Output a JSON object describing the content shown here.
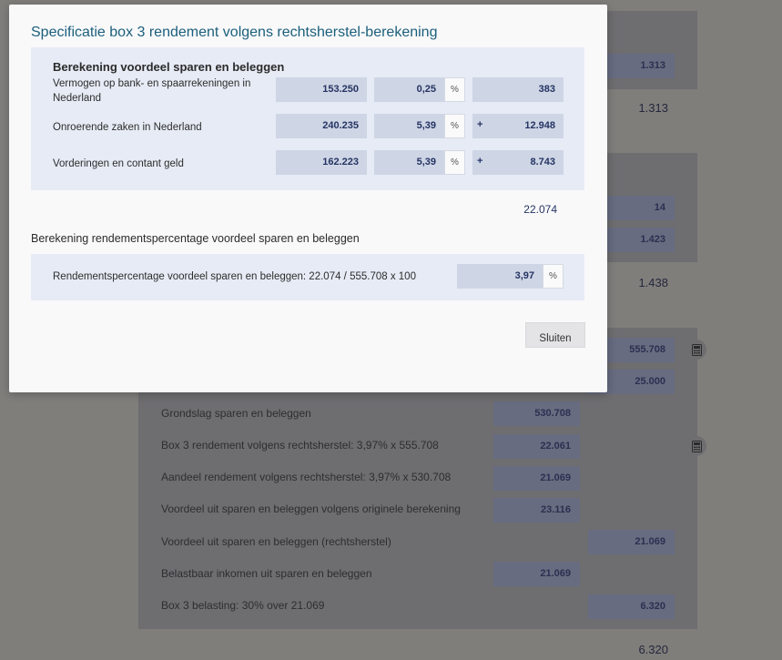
{
  "modal": {
    "title": "Specificatie box 3 rendement volgens rechtsherstel-berekening",
    "section1": {
      "title": "Berekening voordeel sparen en beleggen",
      "rows": [
        {
          "label": "Vermogen op bank- en spaarrekeningen in Nederland",
          "amount": "153.250",
          "percentage": "0,25",
          "percent_sign": "%",
          "operator": "",
          "result": "383"
        },
        {
          "label": "Onroerende zaken in Nederland",
          "amount": "240.235",
          "percentage": "5,39",
          "percent_sign": "%",
          "operator": "+",
          "result": "12.948"
        },
        {
          "label": "Vorderingen en contant geld",
          "amount": "162.223",
          "percentage": "5,39",
          "percent_sign": "%",
          "operator": "+",
          "result": "8.743"
        }
      ],
      "subtotal": "22.074"
    },
    "section2": {
      "title": "Berekening rendementspercentage voordeel sparen en beleggen",
      "row_label": "Rendementspercentage voordeel sparen en beleggen: 22.074 / 555.708 x 100",
      "value": "3,97",
      "percent_sign": "%"
    },
    "close_label": "Sluiten"
  },
  "background": {
    "top_values": {
      "v1": "1.313",
      "total1": "1.313",
      "v2": "14",
      "v3": "1.423",
      "total2": "1.438",
      "v4": "555.708",
      "v5": "25.000"
    },
    "rows": [
      {
        "label": "Grondslag sparen en beleggen",
        "value": "530.708",
        "col": "left"
      },
      {
        "label": "Box 3 rendement volgens rechtsherstel: 3,97% x 555.708",
        "value": "22.061",
        "col": "left"
      },
      {
        "label": "Aandeel rendement volgens rechtsherstel: 3,97% x 530.708",
        "value": "21.069",
        "col": "left"
      },
      {
        "label": "Voordeel uit sparen en beleggen volgens originele berekening",
        "value": "23.116",
        "col": "left"
      },
      {
        "label": "Voordeel uit sparen en beleggen (rechtsherstel)",
        "value": "21.069",
        "col": "right"
      },
      {
        "label": "Belastbaar inkomen uit sparen en beleggen",
        "value": "21.069",
        "col": "left"
      },
      {
        "label": "Box 3 belasting: 30% over 21.069",
        "value": "6.320",
        "col": "right"
      }
    ],
    "final_total": "6.320"
  },
  "icons": {
    "calculator": "calculator-icon"
  },
  "colors": {
    "title": "#1b5f7b",
    "section_bg": "#e6ebf5",
    "field_bg": "#ced5e5",
    "field_text": "#253463",
    "overlay": "#807e7b"
  }
}
